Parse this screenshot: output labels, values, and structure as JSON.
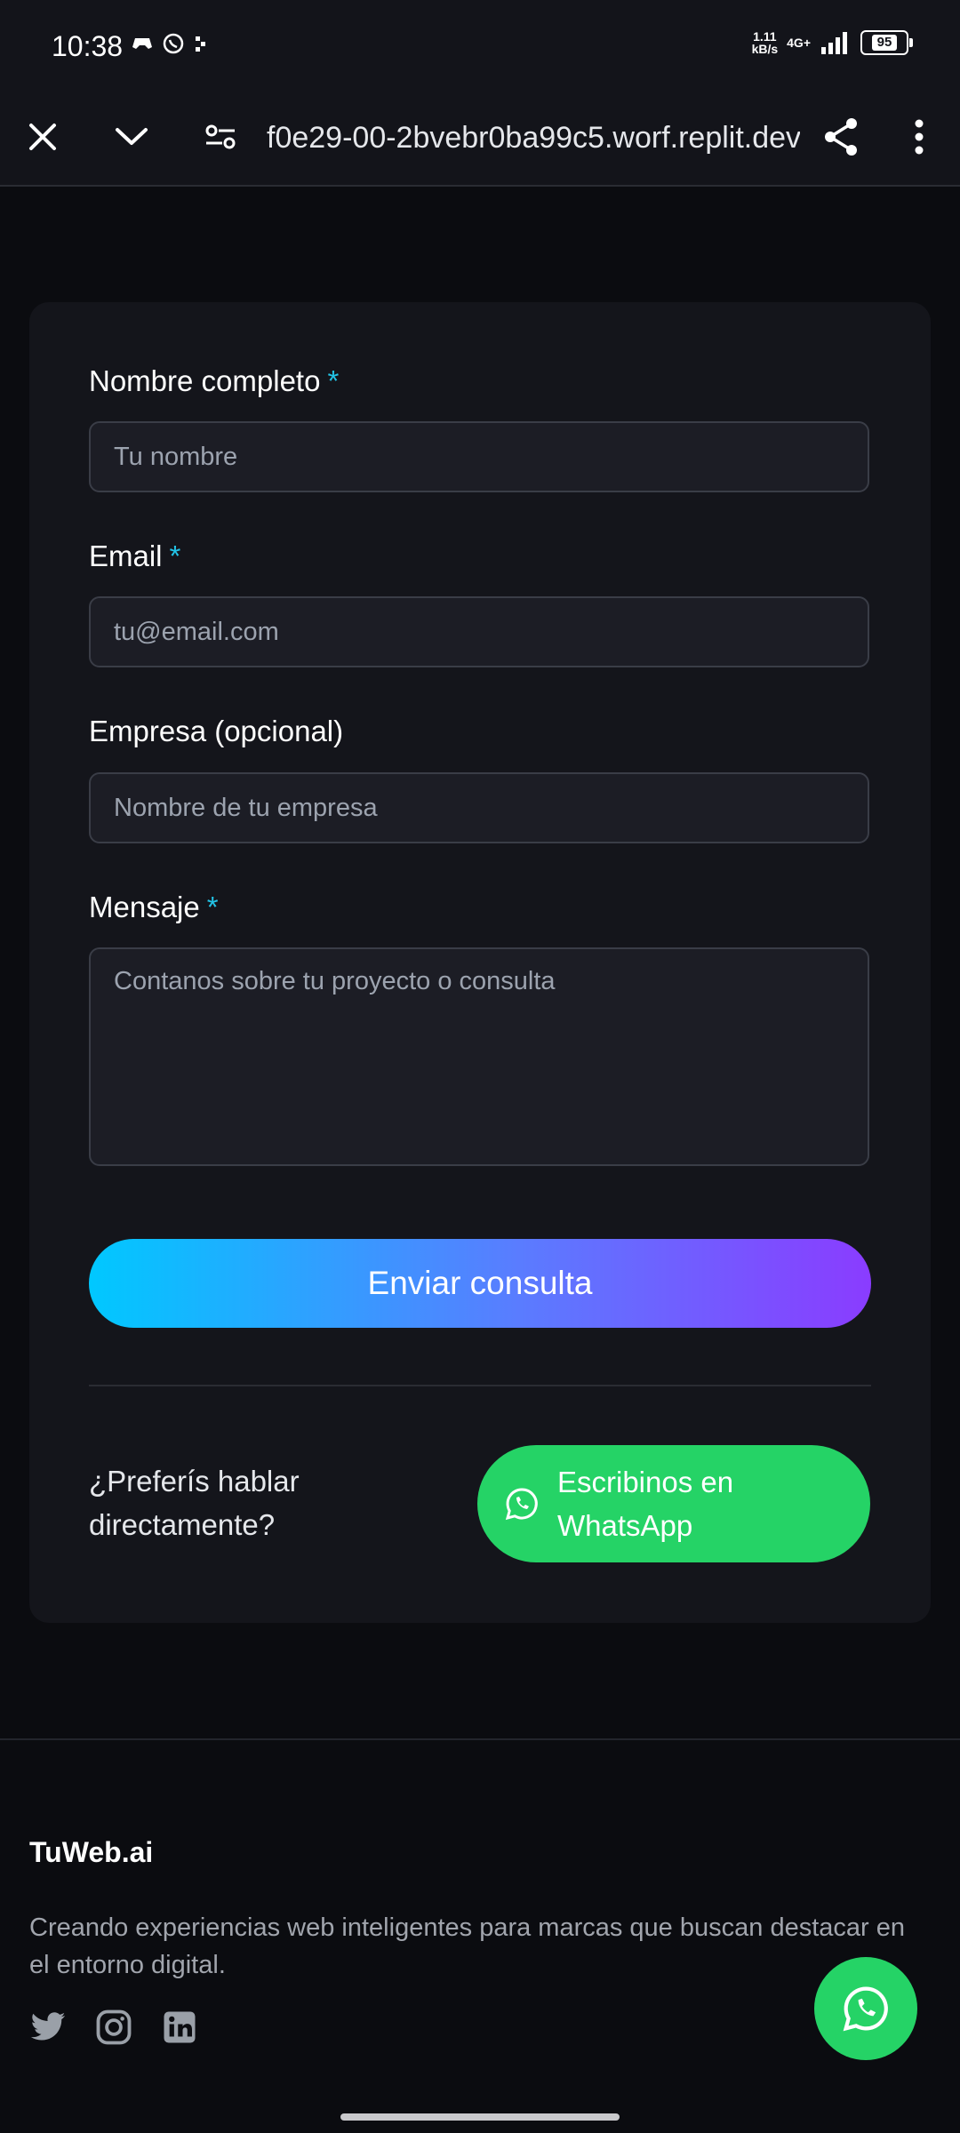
{
  "status_bar": {
    "time": "10:38",
    "net_rate_value": "1.11",
    "net_rate_unit": "kB/s",
    "net_type": "4G+",
    "battery": "95"
  },
  "browser": {
    "url": "f0e29-00-2bvebr0ba99c5.worf.replit.dev",
    "icons": [
      "close-icon",
      "chevron-down-icon",
      "site-settings-icon",
      "share-icon",
      "more-vert-icon"
    ]
  },
  "form": {
    "name_label": "Nombre completo",
    "name_placeholder": "Tu nombre",
    "email_label": "Email",
    "email_placeholder": "tu@email.com",
    "company_label": "Empresa (opcional)",
    "company_placeholder": "Nombre de tu empresa",
    "message_label": "Mensaje",
    "message_placeholder": "Contanos sobre tu proyecto o consulta",
    "required_mark": "*",
    "submit_label": "Enviar consulta",
    "prefer_text": "¿Preferís hablar directamente?",
    "whatsapp_label": "Escribinos en WhatsApp"
  },
  "footer": {
    "brand": "TuWeb.ai",
    "tagline": "Creando experiencias web inteligentes para marcas que buscan destacar en el entorno digital.",
    "socials": [
      "twitter-icon",
      "instagram-icon",
      "linkedin-icon"
    ]
  },
  "colors": {
    "background": "#0b0c10",
    "card": "#14151b",
    "accent_cyan": "#22c3e6",
    "gradient_start": "#00c8ff",
    "gradient_end": "#8a3cff",
    "whatsapp_green": "#25d366"
  }
}
